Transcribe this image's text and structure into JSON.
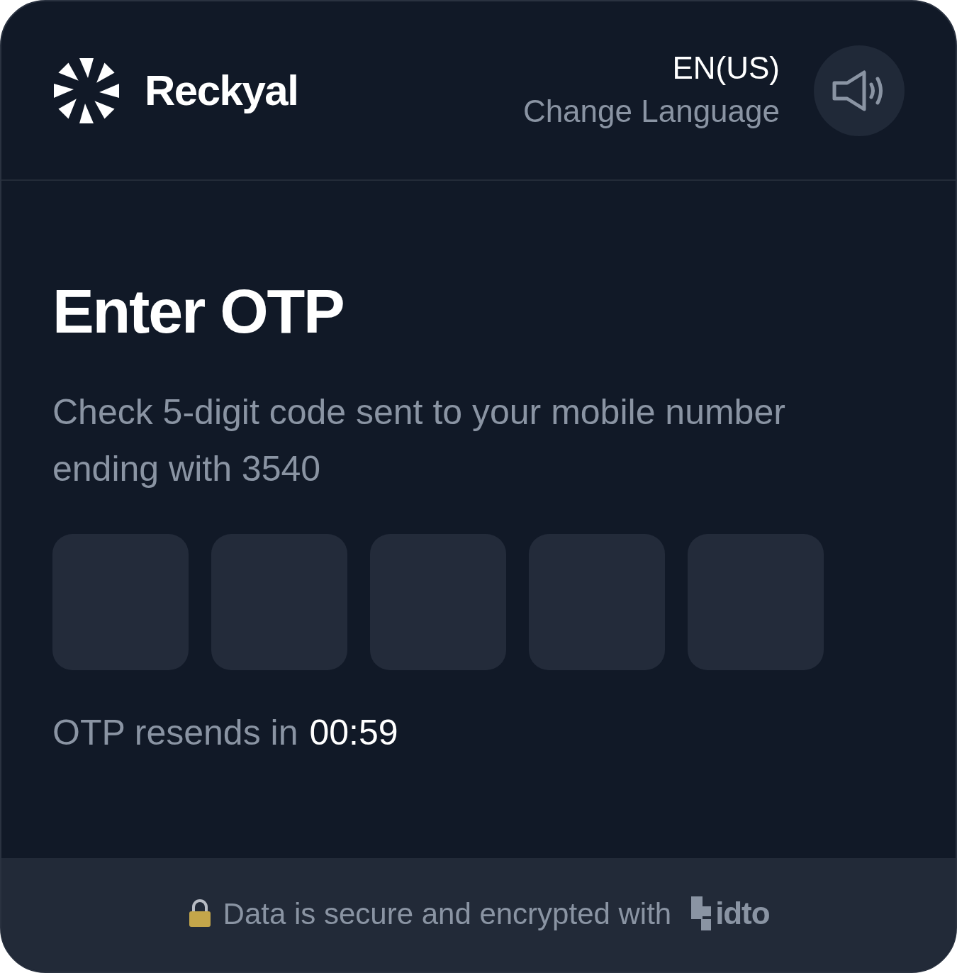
{
  "header": {
    "logo_text": "Reckyal",
    "language_code": "EN(US)",
    "language_action": "Change Language"
  },
  "otp": {
    "title": "Enter OTP",
    "description": "Check 5-digit code sent to your mobile number ending with 3540",
    "boxes": [
      {
        "focused": false
      },
      {
        "focused": false
      },
      {
        "focused": false
      },
      {
        "focused": false
      },
      {
        "focused": false
      }
    ],
    "resend_label": "OTP resends in",
    "resend_time": "00:59"
  },
  "footer": {
    "text": "Data is secure and encrypted with",
    "brand": "idto"
  }
}
